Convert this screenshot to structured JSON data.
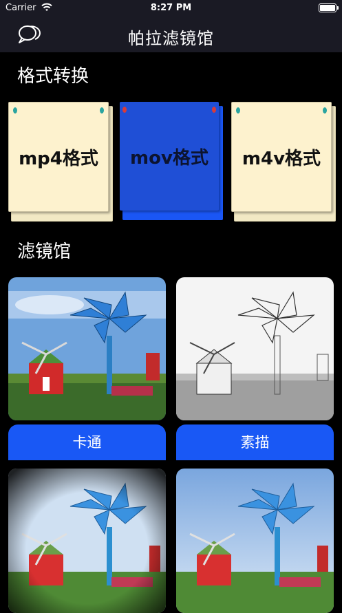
{
  "status_bar": {
    "carrier": "Carrier",
    "time": "8:27 PM"
  },
  "nav": {
    "title": "帕拉滤镜馆",
    "icon": "chat-bubbles-icon"
  },
  "format_section": {
    "title": "格式转换",
    "cards": [
      {
        "label": "mp4格式",
        "style": "cream"
      },
      {
        "label": "mov格式",
        "style": "blue"
      },
      {
        "label": "m4v格式",
        "style": "cream"
      }
    ]
  },
  "filter_section": {
    "title": "滤镜馆",
    "items": [
      {
        "label": "卡通",
        "image": "windmill-cartoon"
      },
      {
        "label": "素描",
        "image": "windmill-sketch"
      },
      {
        "image": "windmill-vignette"
      },
      {
        "image": "windmill-original"
      }
    ]
  },
  "colors": {
    "accent": "#1958f5",
    "card_cream": "#fdf2ce",
    "nav_bg": "#1a1a24"
  }
}
